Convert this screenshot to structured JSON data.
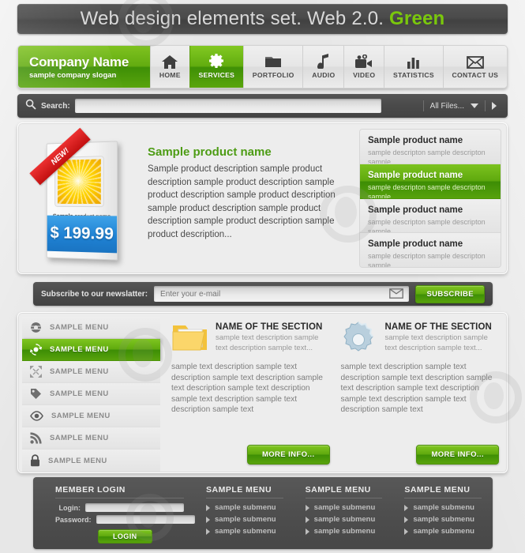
{
  "header": {
    "title_main": "Web design elements set. Web 2.0.",
    "title_accent": "Green"
  },
  "nav": {
    "brand_name": "Company Name",
    "brand_slogan": "sample company slogan",
    "items": [
      {
        "label": "HOME",
        "icon": "home-icon",
        "active": false
      },
      {
        "label": "SERVICES",
        "icon": "gear-icon",
        "active": true
      },
      {
        "label": "PORTFOLIO",
        "icon": "folder-icon",
        "active": false
      },
      {
        "label": "AUDIO",
        "icon": "music-note-icon",
        "active": false
      },
      {
        "label": "VIDEO",
        "icon": "video-camera-icon",
        "active": false
      },
      {
        "label": "STATISTICS",
        "icon": "bar-chart-icon",
        "active": false
      },
      {
        "label": "CONTACT US",
        "icon": "envelope-icon",
        "active": false
      }
    ]
  },
  "search": {
    "label": "Search:",
    "value": "",
    "placeholder": "",
    "filter_selected": "All Files..."
  },
  "showcase": {
    "box": {
      "ribbon": "NEW!",
      "caption_bold": "Sample",
      "caption_rest": " product name",
      "price": "$ 199.99"
    },
    "product_title": "Sample product name",
    "product_description": "Sample product description sample product description sample product description sample product description sample product description sample product description sample product description sample product description sample product description...",
    "list": [
      {
        "title": "Sample product name",
        "sub": "sample descripton sample descripton sample",
        "active": false
      },
      {
        "title": "Sample product name",
        "sub": "sample descripton sample descripton sample",
        "active": true
      },
      {
        "title": "Sample product name",
        "sub": "sample descripton sample descripton sample",
        "active": false
      },
      {
        "title": "Sample product name",
        "sub": "sample descripton sample descripton sample",
        "active": false
      }
    ]
  },
  "newsletter": {
    "label": "Subscribe to our newslatter:",
    "input_value": "",
    "input_placeholder": "Enter your e-mail",
    "button": "SUBSCRIBE"
  },
  "content": {
    "sidemenu": [
      {
        "label": "SAMPLE MENU",
        "icon": "globe-icon",
        "active": false
      },
      {
        "label": "SAMPLE MENU",
        "icon": "refresh-icon",
        "active": true
      },
      {
        "label": "SAMPLE MENU",
        "icon": "expand-icon",
        "active": false
      },
      {
        "label": "SAMPLE MENU",
        "icon": "tag-icon",
        "active": false
      },
      {
        "label": "SAMPLE MENU",
        "icon": "eye-icon",
        "active": false
      },
      {
        "label": "SAMPLE MENU",
        "icon": "rss-icon",
        "active": false
      },
      {
        "label": "SAMPLE MENU",
        "icon": "lock-icon",
        "active": false
      }
    ],
    "panes": [
      {
        "icon": "folder-icon",
        "title": "NAME OF THE SECTION",
        "sub": "sample text description sample text description sample text...",
        "body": "sample text description sample text description sample text description sample text description sample text description sample text description sample text description sample text",
        "button": "MORE INFO..."
      },
      {
        "icon": "gear-icon",
        "title": "NAME OF THE SECTION",
        "sub": "sample text description sample text description sample text...",
        "body": "sample text description sample text description sample text description sample text description sample text description sample text description sample text description sample text",
        "button": "MORE INFO..."
      }
    ]
  },
  "footer": {
    "login": {
      "heading": "MEMBER LOGIN",
      "login_label": "Login:",
      "login_value": "",
      "password_label": "Password:",
      "password_value": "",
      "button": "LOGIN"
    },
    "menus": [
      {
        "heading": "SAMPLE MENU",
        "items": [
          "sample submenu",
          "sample submenu",
          "sample submenu"
        ]
      },
      {
        "heading": "SAMPLE MENU",
        "items": [
          "sample submenu",
          "sample submenu",
          "sample submenu"
        ]
      },
      {
        "heading": "SAMPLE MENU",
        "items": [
          "sample submenu",
          "sample submenu",
          "sample submenu"
        ]
      }
    ]
  },
  "colors": {
    "green_accent": "#7ac70c",
    "green_dark": "#3e8f05",
    "dark_bar": "#4a4a4a",
    "price_blue": "#1f82d4",
    "ribbon_red": "#c21010"
  }
}
